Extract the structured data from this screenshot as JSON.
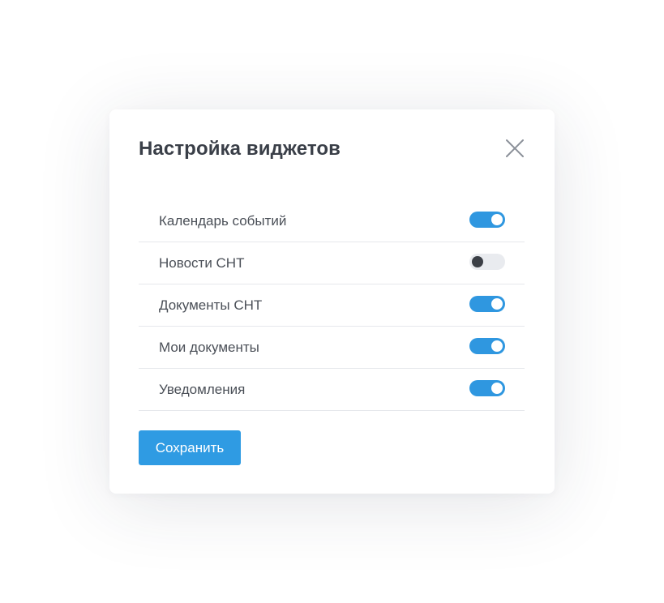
{
  "dialog": {
    "title": "Настройка виджетов",
    "close_icon": "close-icon",
    "save_label": "Сохранить"
  },
  "widgets": [
    {
      "label": "Календарь событий",
      "enabled": true
    },
    {
      "label": "Новости СНТ",
      "enabled": false
    },
    {
      "label": "Документы СНТ",
      "enabled": true
    },
    {
      "label": "Мои документы",
      "enabled": true
    },
    {
      "label": "Уведомления",
      "enabled": true
    }
  ],
  "colors": {
    "accent": "#2f97e0",
    "toggle_off_track": "#e9ebef",
    "toggle_off_knob": "#3b3f46",
    "title_text": "#3a3f48",
    "label_text": "#4a4f57",
    "divider": "#e6e8ec"
  }
}
